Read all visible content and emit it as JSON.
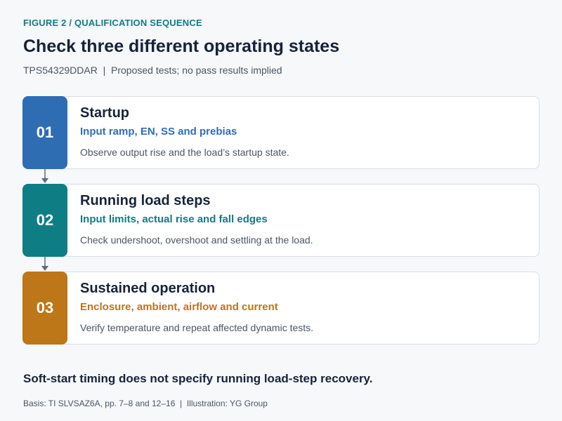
{
  "figure_label": "FIGURE 2 / QUALIFICATION SEQUENCE",
  "title": "Check three different operating states",
  "subtitle": "TPS54329DDAR  |  Proposed tests; no pass results implied",
  "steps": [
    {
      "number": "01",
      "title": "Startup",
      "subtitle": "Input ramp, EN, SS and prebias",
      "description": "Observe output rise and the load’s startup state.",
      "color": "#2f6db3"
    },
    {
      "number": "02",
      "title": "Running load steps",
      "subtitle": "Input limits, actual rise and fall edges",
      "description": "Check undershoot, overshoot and settling at the load.",
      "color": "#0f7d84"
    },
    {
      "number": "03",
      "title": "Sustained operation",
      "subtitle": "Enclosure, ambient, airflow and current",
      "description": "Verify temperature and repeat affected dynamic tests.",
      "color": "#bd7618"
    }
  ],
  "connector_color": "#5f6b7a",
  "conclusion": "Soft-start timing does not specify running load-step recovery.",
  "source": "Basis: TI SLVSAZ6A, pp. 7–8 and 12–16  |  Illustration: YG Group"
}
